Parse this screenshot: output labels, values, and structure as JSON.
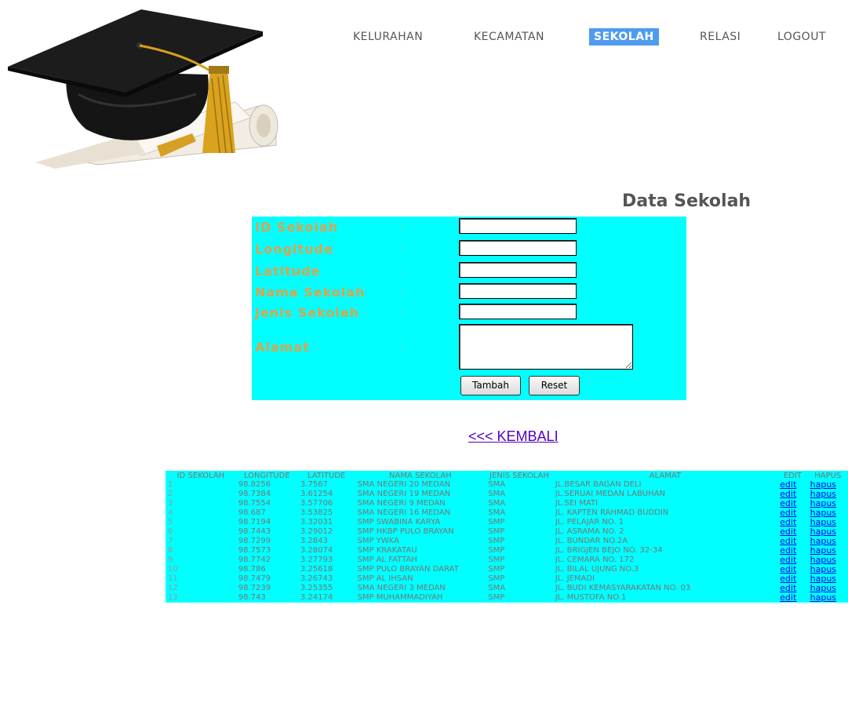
{
  "nav": {
    "items": [
      {
        "label": "KELURAHAN"
      },
      {
        "label": "KECAMATAN"
      },
      {
        "label": "SEKOLAH"
      },
      {
        "label": "RELASI"
      },
      {
        "label": "LOGOUT"
      }
    ]
  },
  "page": {
    "title": "Data Sekolah"
  },
  "form": {
    "fields": [
      {
        "label": "ID Sekolah",
        "colon": ":",
        "value": ""
      },
      {
        "label": "Longitude",
        "colon": ":",
        "value": ""
      },
      {
        "label": "Latitude",
        "colon": ":",
        "value": ""
      },
      {
        "label": "Nama Sekolah",
        "colon": ":",
        "value": ""
      },
      {
        "label": "Jenis Sekolah",
        "colon": ":",
        "value": ""
      }
    ],
    "alamat": {
      "label": "Alamat",
      "colon": ":",
      "value": ""
    },
    "submit_label": "Tambah",
    "reset_label": "Reset"
  },
  "back_link": "<<< KEMBALI",
  "table": {
    "headers": [
      "ID SEKOLAH",
      "LONGITUDE",
      "LATITUDE",
      "NAMA SEKOLAH",
      "JENIS SEKOLAH",
      "ALAMAT",
      "EDIT",
      "HAPUS"
    ],
    "edit_label": "edit",
    "hapus_label": "hapus",
    "rows": [
      {
        "id": "1",
        "lon": "98.8256",
        "lat": "3.7567",
        "nama": "SMA NEGERI 20 MEDAN",
        "jenis": "SMA",
        "alamat": "JL.BESAR BAGAN DELI"
      },
      {
        "id": "2",
        "lon": "98.7384",
        "lat": "3.61254",
        "nama": "SMA NEGERI 19 MEDAN",
        "jenis": "SMA",
        "alamat": "JL.SERUAI MEDAN LABUHAN"
      },
      {
        "id": "3",
        "lon": "98.7554",
        "lat": "3.57706",
        "nama": "SMA NEGERI 9 MEDAN",
        "jenis": "SMA",
        "alamat": "JL.SEI MATI"
      },
      {
        "id": "4",
        "lon": "98.687",
        "lat": "3.53825",
        "nama": "SMA NEGERI 16 MEDAN",
        "jenis": "SMA",
        "alamat": "JL. KAPTEN RAHMAD BUDDIN"
      },
      {
        "id": "5",
        "lon": "98.7194",
        "lat": "3.32031",
        "nama": "SMP SWABINA KARYA",
        "jenis": "SMP",
        "alamat": "JL. PELAJAR NO. 1"
      },
      {
        "id": "6",
        "lon": "98.7443",
        "lat": "3.29012",
        "nama": "SMP HKBP PULO BRAYAN",
        "jenis": "SMP",
        "alamat": "JL. ASRAMA NO. 2"
      },
      {
        "id": "7",
        "lon": "98.7299",
        "lat": "3.2843",
        "nama": "SMP YWKA",
        "jenis": "SMP",
        "alamat": "JL. BUNDAR NO.2A"
      },
      {
        "id": "8",
        "lon": "98.7573",
        "lat": "3.28074",
        "nama": "SMP KRAKATAU",
        "jenis": "SMP",
        "alamat": "JL. BRIGJEN BEJO NO. 32-34"
      },
      {
        "id": "9",
        "lon": "98.7742",
        "lat": "3.27793",
        "nama": "SMP AL FATTAH",
        "jenis": "SMP",
        "alamat": "JL. CEMARA NO. 172"
      },
      {
        "id": "10",
        "lon": "98.786",
        "lat": "3.25618",
        "nama": "SMP PULO BRAYAN DARAT",
        "jenis": "SMP",
        "alamat": "JL. BILAL UJUNG NO.3"
      },
      {
        "id": "11",
        "lon": "98.7479",
        "lat": "3.26743",
        "nama": "SMP AL IHSAN",
        "jenis": "SMP",
        "alamat": "JL. JEMADI"
      },
      {
        "id": "12",
        "lon": "98.7239",
        "lat": "3.25355",
        "nama": "SMA NEGERI 3 MEDAN",
        "jenis": "SMA",
        "alamat": "JL. BUDI KEMASYARAKATAN NO. 03"
      },
      {
        "id": "13",
        "lon": "98.743",
        "lat": "3.24174",
        "nama": "SMP MUHAMMADIYAH",
        "jenis": "SMP",
        "alamat": "JL. MUSTOFA NO.1"
      }
    ]
  },
  "colors": {
    "panel": "#00ffff",
    "label": "#e0a24a",
    "nav_active": "#4f9bf0",
    "link": "#0000ee"
  }
}
